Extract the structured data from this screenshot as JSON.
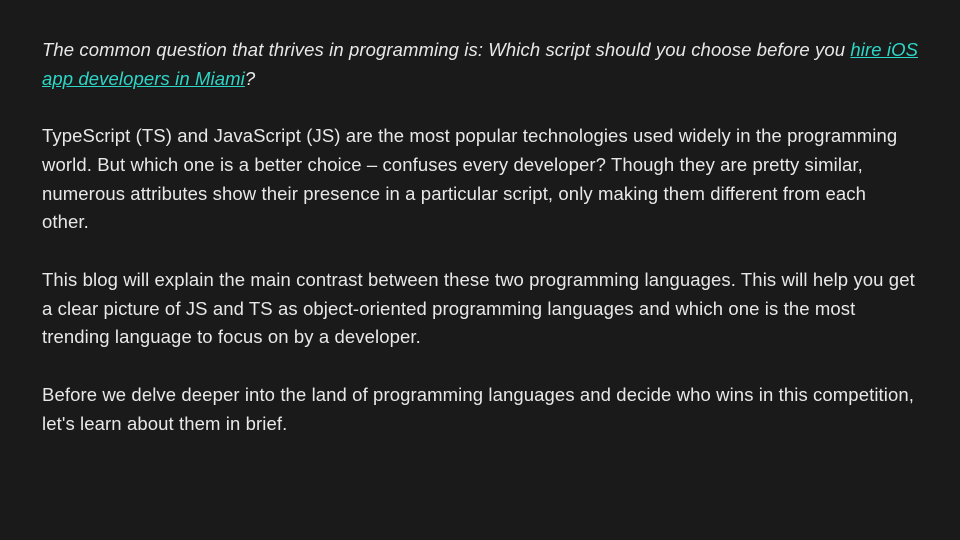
{
  "intro": {
    "pre_link": "The common question that thrives in programming is: Which script should you choose before you ",
    "link_text": "hire iOS app developers in Miami",
    "post_link": "?"
  },
  "paragraphs": [
    "TypeScript (TS) and JavaScript (JS) are the most popular technologies used widely in the programming world. But which one is a better choice – confuses every developer? Though they are pretty similar, numerous attributes show their presence in a particular script, only making them different from each other.",
    "This blog will explain the main contrast between these two programming languages. This will help you get a clear picture of JS and TS as object-oriented programming languages and which one is the most trending language to focus on by a developer.",
    "Before we delve deeper into the land of programming languages and decide who wins in this competition, let's learn about them in brief."
  ]
}
